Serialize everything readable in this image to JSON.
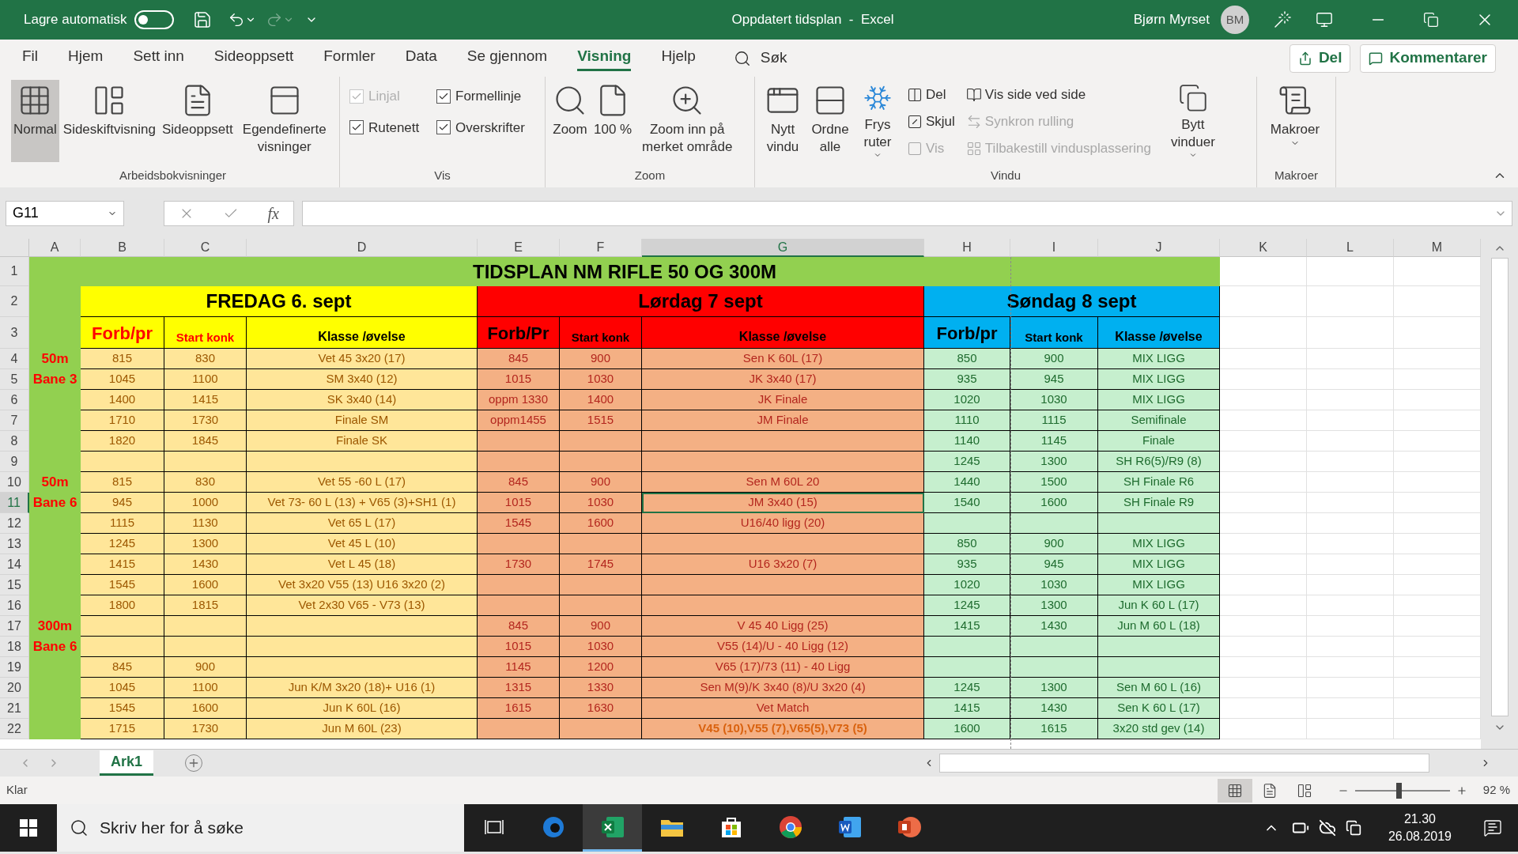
{
  "title_bar": {
    "autosave": {
      "label": "Lagre automatisk",
      "on": false
    },
    "title": "Oppdatert tidsplan  -  Excel",
    "user": "Bjørn Myrset",
    "avatar": "BM"
  },
  "ribbon": {
    "tabs": [
      {
        "label": "Fil",
        "selected": false
      },
      {
        "label": "Hjem",
        "selected": false
      },
      {
        "label": "Sett inn",
        "selected": false
      },
      {
        "label": "Sideoppsett",
        "selected": false
      },
      {
        "label": "Formler",
        "selected": false
      },
      {
        "label": "Data",
        "selected": false
      },
      {
        "label": "Se gjennom",
        "selected": false
      },
      {
        "label": "Visning",
        "selected": true
      },
      {
        "label": "Hjelp",
        "selected": false
      }
    ],
    "search": "Søk",
    "share": "Del",
    "comments": "Kommentarer",
    "groups": [
      {
        "label": "Arbeidsbokvisninger",
        "kind": "views",
        "items": [
          {
            "label": "Normal",
            "selected": true
          },
          {
            "label": "Sideskiftvisning",
            "selected": false
          },
          {
            "label": "Sideoppsett",
            "selected": false
          },
          {
            "label": "Egendefinerte visninger",
            "selected": false
          }
        ]
      },
      {
        "label": "Vis",
        "kind": "checks",
        "items": [
          {
            "label": "Linjal",
            "checked": true,
            "disabled": true
          },
          {
            "label": "Formellinje",
            "checked": true,
            "disabled": false
          },
          {
            "label": "Rutenett",
            "checked": true,
            "disabled": false
          },
          {
            "label": "Overskrifter",
            "checked": true,
            "disabled": false
          }
        ]
      },
      {
        "label": "Zoom",
        "kind": "zoom",
        "items": [
          {
            "label": "Zoom"
          },
          {
            "label": "100 %"
          },
          {
            "label": "Zoom inn på merket område"
          }
        ]
      },
      {
        "label": "Vindu",
        "kind": "window",
        "large": [
          {
            "label": "Nytt vindu",
            "dropdown": false
          },
          {
            "label": "Ordne alle",
            "dropdown": false
          },
          {
            "label": "Frys ruter",
            "dropdown": true
          }
        ],
        "small": [
          {
            "label": "Del",
            "disabled": false
          },
          {
            "label": "Skjul",
            "disabled": false
          },
          {
            "label": "Vis",
            "disabled": true
          },
          {
            "label": "Vis side ved side",
            "disabled": false
          },
          {
            "label": "Synkron rulling",
            "disabled": true
          },
          {
            "label": "Tilbakestill vindusplassering",
            "disabled": true
          }
        ],
        "switch": {
          "label": "Bytt vinduer",
          "dropdown": true
        }
      },
      {
        "label": "Makroer",
        "kind": "macros",
        "items": [
          {
            "label": "Makroer"
          }
        ]
      }
    ]
  },
  "formula_bar": {
    "name_box": "G11",
    "function_symbol": "fx"
  },
  "sheet": {
    "columns": [
      {
        "label": "A",
        "selected": false
      },
      {
        "label": "B",
        "selected": false
      },
      {
        "label": "C",
        "selected": false
      },
      {
        "label": "D",
        "selected": false
      },
      {
        "label": "E",
        "selected": false
      },
      {
        "label": "F",
        "selected": false
      },
      {
        "label": "G",
        "selected": true
      },
      {
        "label": "H",
        "selected": false
      },
      {
        "label": "I",
        "selected": false
      },
      {
        "label": "J",
        "selected": false
      },
      {
        "label": "K",
        "selected": false
      },
      {
        "label": "L",
        "selected": false
      },
      {
        "label": "M",
        "selected": false
      }
    ],
    "title_row": {
      "number": "1",
      "text": "TIDSPLAN NM RIFLE 50 OG 300M"
    },
    "day_row": {
      "number": "2"
    },
    "header_row": {
      "number": "3"
    },
    "days": [
      {
        "label": "FREDAG 6. sept",
        "color": "#ffff00",
        "headers": [
          "Forb/pr",
          "Start konk",
          "Klasse /øvelse"
        ]
      },
      {
        "label": "Lørdag 7 sept",
        "color": "#ff0000",
        "headers": [
          "Forb/Pr",
          "Start konk",
          "Klasse /øvelse"
        ]
      },
      {
        "label": "Søndag 8 sept",
        "color": "#00b0f0",
        "headers": [
          "Forb/pr",
          "Start konk",
          "Klasse /øvelse"
        ]
      }
    ],
    "rows": [
      {
        "number": "4",
        "selected": false,
        "cells": [
          "50m",
          "815",
          "830",
          "Vet 45 3x20 (17)",
          "845",
          "900",
          "Sen K 60L (17)",
          "850",
          "900",
          "MIX LIGG"
        ]
      },
      {
        "number": "5",
        "selected": false,
        "cells": [
          "Bane 3",
          "1045",
          "1100",
          "SM 3x40 (12)",
          "1015",
          "1030",
          "JK 3x40 (17)",
          "935",
          "945",
          "MIX LIGG"
        ]
      },
      {
        "number": "6",
        "selected": false,
        "cells": [
          null,
          "1400",
          "1415",
          "SK 3x40 (14)",
          "oppm 1330",
          "1400",
          "JK Finale",
          "1020",
          "1030",
          "MIX LIGG"
        ]
      },
      {
        "number": "7",
        "selected": false,
        "cells": [
          null,
          "1710",
          "1730",
          "Finale SM",
          "oppm1455",
          "1515",
          "JM Finale",
          "1110",
          "1115",
          "Semifinale"
        ]
      },
      {
        "number": "8",
        "selected": false,
        "cells": [
          null,
          "1820",
          "1845",
          "Finale SK",
          null,
          null,
          null,
          "1140",
          "1145",
          "Finale"
        ]
      },
      {
        "number": "9",
        "selected": false,
        "cells": [
          null,
          null,
          null,
          null,
          null,
          null,
          null,
          "1245",
          "1300",
          "SH R6(5)/R9 (8)"
        ]
      },
      {
        "number": "10",
        "selected": false,
        "cells": [
          "50m",
          "815",
          "830",
          "Vet 55 -60 L (17)",
          "845",
          "900",
          "Sen M 60L 20",
          "1440",
          "1500",
          "SH Finale R6"
        ]
      },
      {
        "number": "11",
        "selected": true,
        "cells": [
          "Bane 6",
          "945",
          "1000",
          "Vet 73- 60 L (13) + V65 (3)+SH1 (1)",
          "1015",
          "1030",
          "JM 3x40 (15)",
          "1540",
          "1600",
          "SH Finale R9"
        ]
      },
      {
        "number": "12",
        "selected": false,
        "cells": [
          null,
          "1115",
          "1130",
          "Vet 65 L (17)",
          "1545",
          "1600",
          "U16/40 ligg (20)",
          null,
          null,
          null
        ]
      },
      {
        "number": "13",
        "selected": false,
        "cells": [
          null,
          "1245",
          "1300",
          "Vet 45 L (10)",
          null,
          null,
          null,
          "850",
          "900",
          "MIX LIGG"
        ]
      },
      {
        "number": "14",
        "selected": false,
        "cells": [
          null,
          "1415",
          "1430",
          "Vet L 45 (18)",
          "1730",
          "1745",
          "U16 3x20 (7)",
          "935",
          "945",
          "MIX LIGG"
        ]
      },
      {
        "number": "15",
        "selected": false,
        "cells": [
          null,
          "1545",
          "1600",
          "Vet 3x20 V55 (13) U16 3x20 (2)",
          null,
          null,
          null,
          "1020",
          "1030",
          "MIX LIGG"
        ]
      },
      {
        "number": "16",
        "selected": false,
        "cells": [
          null,
          "1800",
          "1815",
          "Vet 2x30 V65 - V73 (13)",
          null,
          null,
          null,
          "1245",
          "1300",
          "Jun K 60 L (17)"
        ]
      },
      {
        "number": "17",
        "selected": false,
        "cells": [
          "300m",
          null,
          null,
          null,
          "845",
          "900",
          "V 45 40 Ligg (25)",
          "1415",
          "1430",
          "Jun M 60 L (18)"
        ]
      },
      {
        "number": "18",
        "selected": false,
        "cells": [
          "Bane 6",
          null,
          null,
          null,
          "1015",
          "1030",
          "V55 (14)/U - 40 Ligg (12)",
          null,
          null,
          null
        ]
      },
      {
        "number": "19",
        "selected": false,
        "cells": [
          null,
          "845",
          "900",
          null,
          "1145",
          "1200",
          "V65 (17)/73 (11) - 40 Ligg",
          null,
          null,
          null
        ]
      },
      {
        "number": "20",
        "selected": false,
        "cells": [
          null,
          "1045",
          "1100",
          "Jun K/M 3x20 (18)+ U16 (1)",
          "1315",
          "1330",
          "Sen M(9)/K 3x40 (8)/U 3x20 (4)",
          "1245",
          "1300",
          "Sen M 60 L (16)"
        ]
      },
      {
        "number": "21",
        "selected": false,
        "cells": [
          null,
          "1545",
          "1600",
          "Jun K 60L (16)",
          "1615",
          "1630",
          "Vet Match",
          "1415",
          "1430",
          "Sen K 60 L (17)"
        ]
      },
      {
        "number": "22",
        "selected": false,
        "cells": [
          null,
          "1715",
          "1730",
          "Jun M 60L  (23)",
          null,
          null,
          {
            "text": "V45 (10),V55 (7),V65(5),V73 (5)",
            "bold": true
          },
          "1600",
          "1615",
          "3x20 std gev (14)"
        ]
      }
    ]
  },
  "sheet_tabs": [
    {
      "label": "Ark1",
      "selected": true
    }
  ],
  "status_bar": {
    "text": "Klar",
    "views": [
      {
        "selected": true
      },
      {
        "selected": false
      },
      {
        "selected": false
      }
    ],
    "zoom": {
      "level": 0.46,
      "reading": "92 %"
    }
  },
  "taskbar": {
    "search_placeholder": "Skriv her for å søke",
    "apps": [
      {
        "kind": "taskview",
        "selected": false
      },
      {
        "kind": "edge",
        "selected": false
      },
      {
        "kind": "excel",
        "selected": true
      },
      {
        "kind": "files",
        "selected": false
      },
      {
        "kind": "store",
        "selected": false
      },
      {
        "kind": "chrome",
        "selected": false
      },
      {
        "kind": "word",
        "selected": false
      },
      {
        "kind": "powerpoint",
        "selected": false
      }
    ],
    "time": "21.30",
    "date": "26.08.2019"
  }
}
